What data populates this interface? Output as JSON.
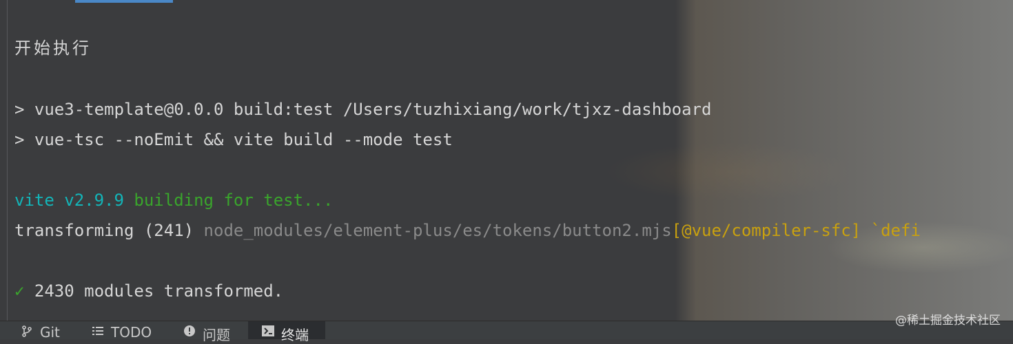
{
  "terminal": {
    "lines": {
      "start": "开始执行",
      "cmd1": "> vue3-template@0.0.0 build:test /Users/tuzhixiang/work/tjxz-dashboard",
      "cmd2": "> vue-tsc --noEmit && vite build --mode test",
      "vite_version": "vite v2.9.9",
      "building": " building for test...",
      "transforming_label": "transforming (241) ",
      "transforming_file": "node_modules/element-plus/es/tokens/button2.mjs",
      "warning": "[@vue/compiler-sfc] `defi",
      "check_mark": "✓",
      "modules": " 2430 modules transformed."
    }
  },
  "tool_tabs": [
    {
      "label": "Git",
      "icon": "git-branch-icon"
    },
    {
      "label": "TODO",
      "icon": "list-icon"
    },
    {
      "label": "问题",
      "icon": "alert-icon"
    },
    {
      "label": "终端",
      "icon": "terminal-icon"
    }
  ],
  "watermark": "@稀土掘金技术社区",
  "colors": {
    "background": "#3b3c3e",
    "cyan": "#13b5b8",
    "green": "#3aa52c",
    "yellow": "#c9a10f",
    "grey": "#8a8a8a",
    "accent": "#4a88c7"
  }
}
